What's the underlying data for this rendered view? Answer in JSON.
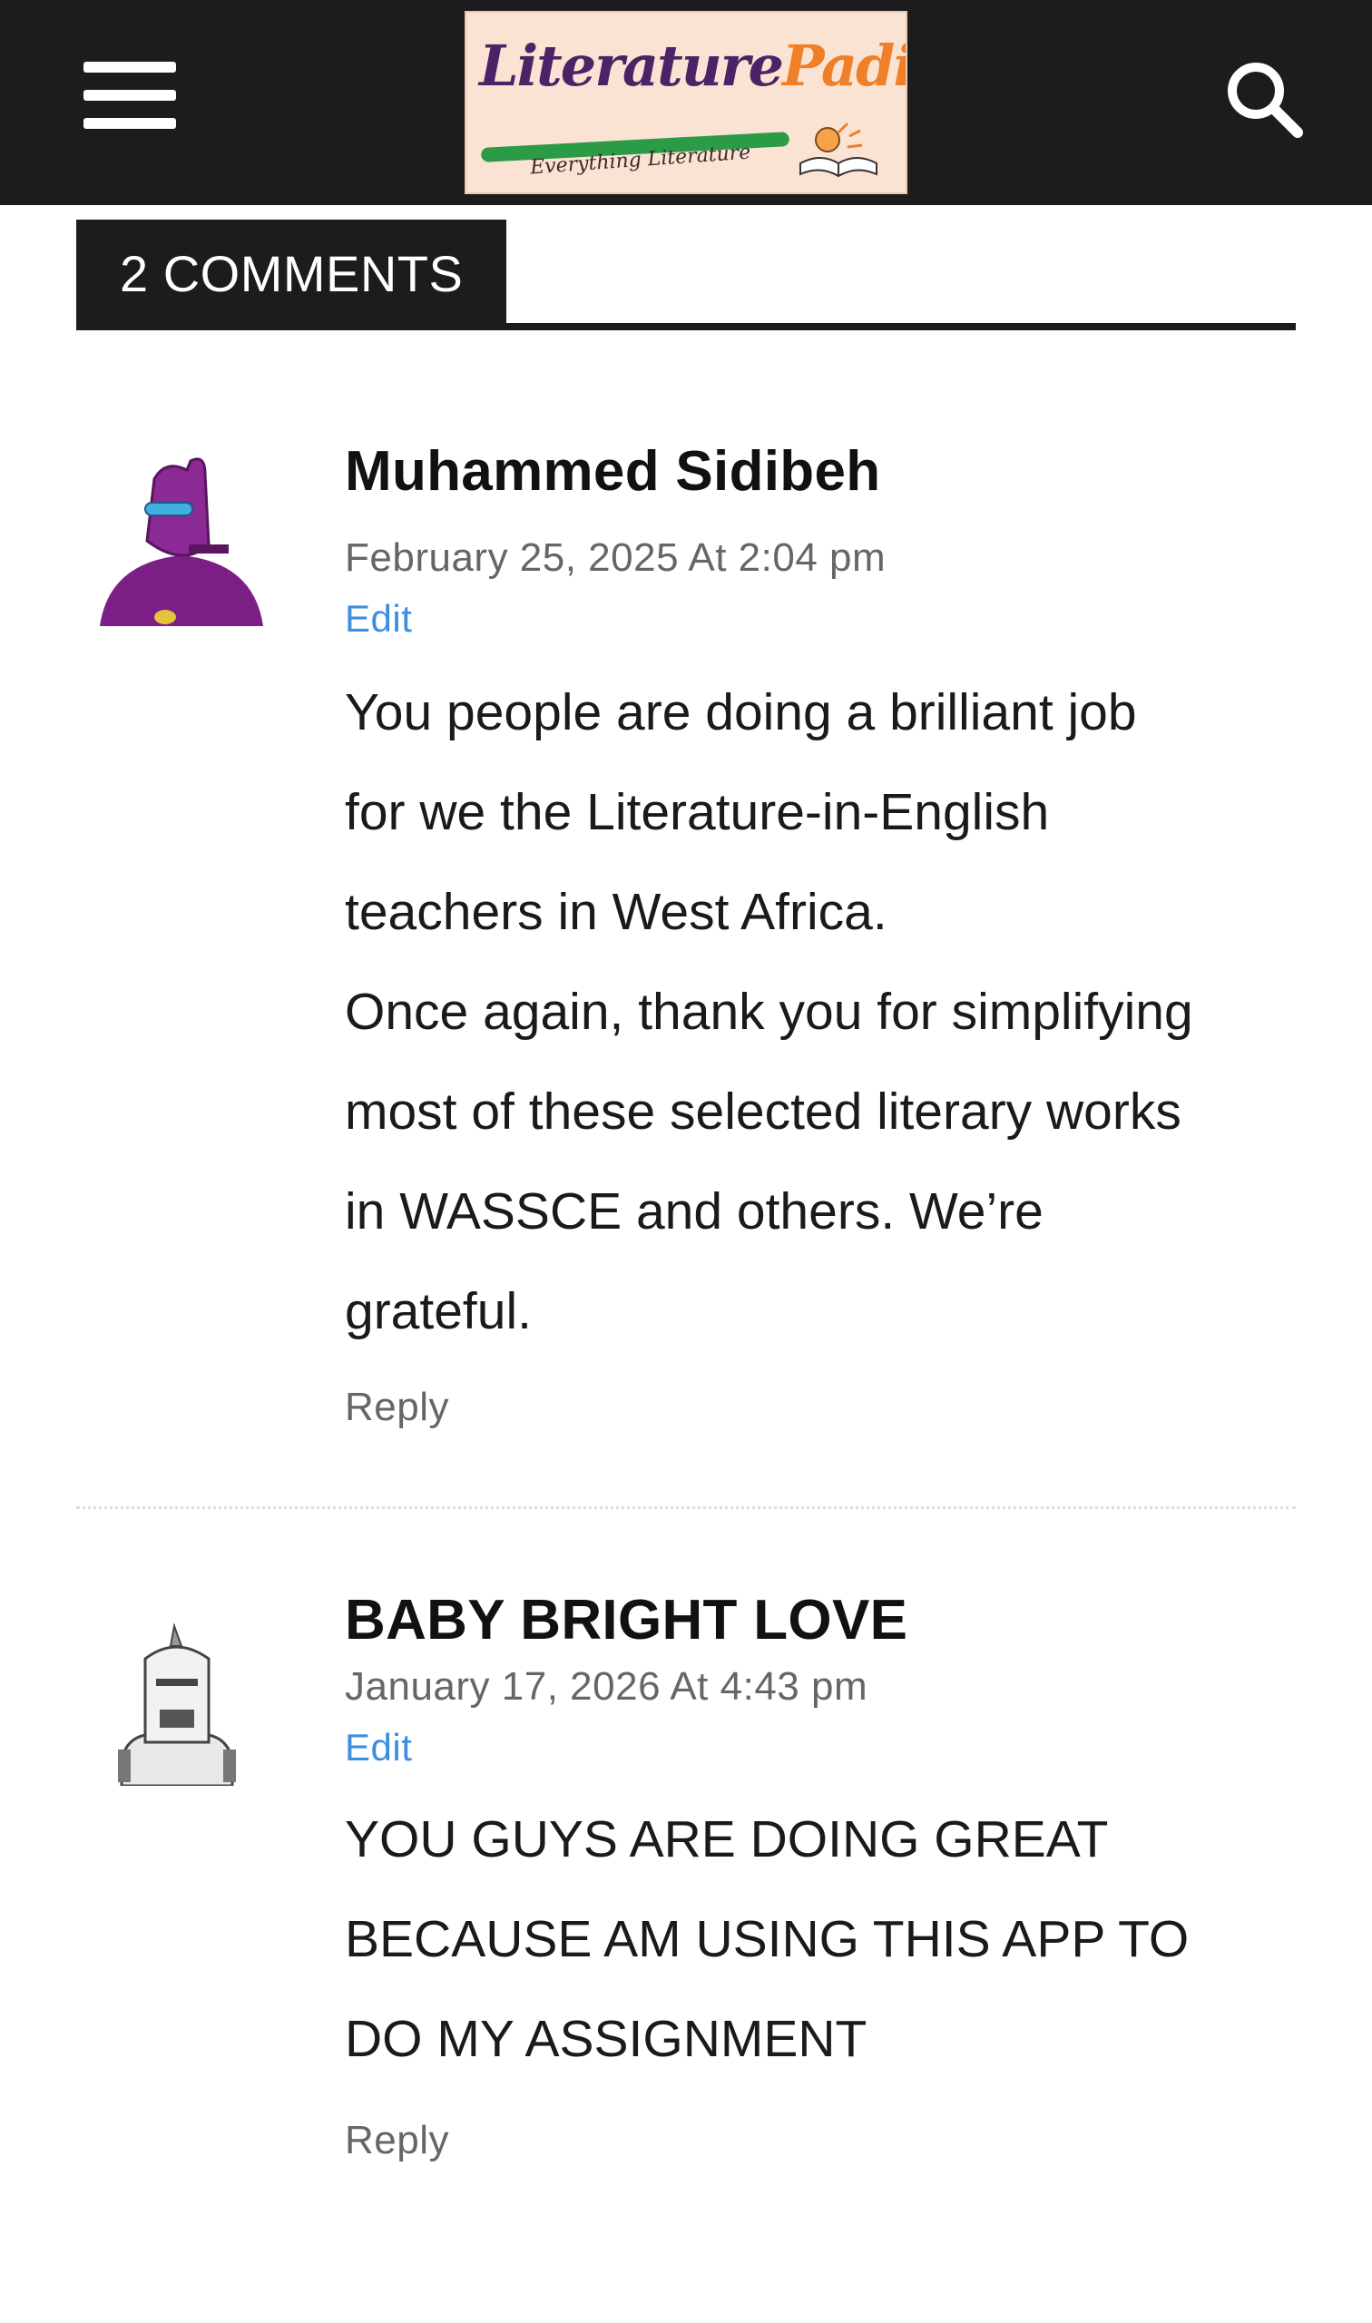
{
  "header": {
    "menu_icon": "hamburger-menu-icon",
    "logo": {
      "word": "Literature",
      "word_accent": "Padi",
      "tagline": "Everything Literature"
    },
    "search_icon": "search-icon",
    "colors": {
      "bar": "#1c1c1c",
      "logo_purple": "#4b2366",
      "logo_orange": "#f07f27",
      "logo_green": "#2c9b47"
    }
  },
  "comments_section": {
    "title": "2 COMMENTS",
    "comments": [
      {
        "author": "Muhammed Sidibeh",
        "date": "February 25, 2025 At 2:04 pm",
        "edit_label": "Edit",
        "body_lines": [
          "You people are doing a brilliant job",
          "for we the Literature-in-English",
          "teachers in West Africa.",
          "Once again, thank you for simplifying",
          "most of these selected literary works",
          "in WASSCE and others. We’re",
          "grateful."
        ],
        "reply_label": "Reply",
        "avatar_icon": "purple-robot-avatar-icon"
      },
      {
        "author": "BABY BRIGHT LOVE",
        "date": "January 17, 2026 At 4:43 pm",
        "edit_label": "Edit",
        "body_lines": [
          "YOU GUYS ARE DOING GREAT",
          "BECAUSE AM USING THIS APP TO",
          "DO MY ASSIGNMENT"
        ],
        "reply_label": "Reply",
        "avatar_icon": "white-robot-avatar-icon"
      }
    ]
  }
}
